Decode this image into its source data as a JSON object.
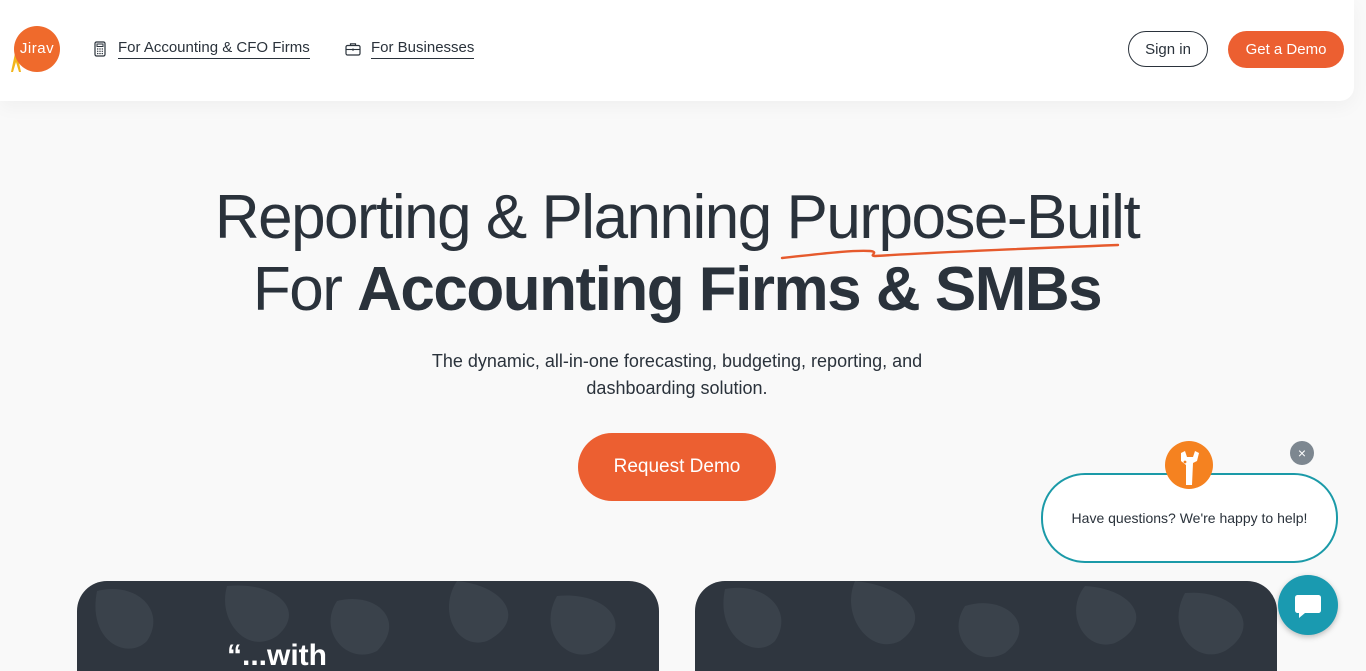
{
  "brand": {
    "logo_text": "Jirav",
    "accent": "#ec5f31",
    "teal": "#1a9ab0"
  },
  "nav": {
    "links": [
      {
        "label": "For Accounting & CFO Firms",
        "icon": "calculator-icon"
      },
      {
        "label": "For Businesses",
        "icon": "briefcase-icon"
      }
    ],
    "signin_label": "Sign in",
    "demo_label": "Get a Demo"
  },
  "hero": {
    "line1_plain": "Reporting & Planning ",
    "line1_highlight": "Purpose-Built",
    "line2_plain": "For ",
    "line2_bold": "Accounting Firms & SMBs",
    "subtitle": "The dynamic, all-in-one forecasting, budgeting, reporting, and dashboarding solution.",
    "cta_label": "Request Demo"
  },
  "cards": {
    "left_partial_text": "“...with"
  },
  "chat": {
    "message": "Have questions? We're happy to help!",
    "close_symbol": "×"
  }
}
